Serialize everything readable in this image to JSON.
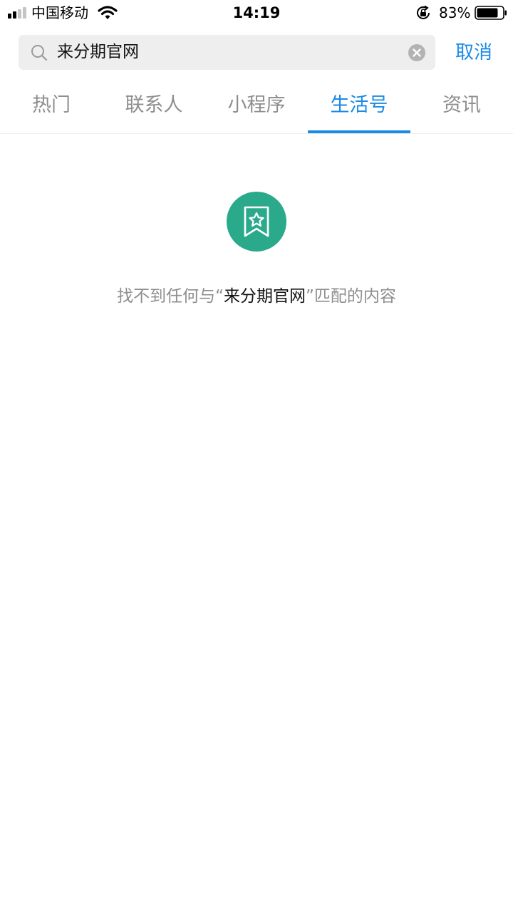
{
  "status_bar": {
    "carrier": "中国移动",
    "time": "14:19",
    "battery_percent": "83%",
    "battery_level": 0.83,
    "signal_bars_filled": 2,
    "signal_bars_total": 4
  },
  "search": {
    "query": "来分期官网",
    "cancel_label": "取消"
  },
  "tabs": [
    {
      "label": "热门"
    },
    {
      "label": "联系人"
    },
    {
      "label": "小程序"
    },
    {
      "label": "生活号"
    },
    {
      "label": "资讯"
    }
  ],
  "active_tab": "生活号",
  "empty_state": {
    "icon": "bookmark-star-icon",
    "message_prefix": "找不到任何与“",
    "keyword": "来分期官网",
    "message_suffix": "”匹配的内容"
  },
  "colors": {
    "accent": "#1a8ae5",
    "empty_icon_bg": "#2aaa8a",
    "muted_text": "#8e8e8e",
    "search_bg": "#eeeeee"
  }
}
